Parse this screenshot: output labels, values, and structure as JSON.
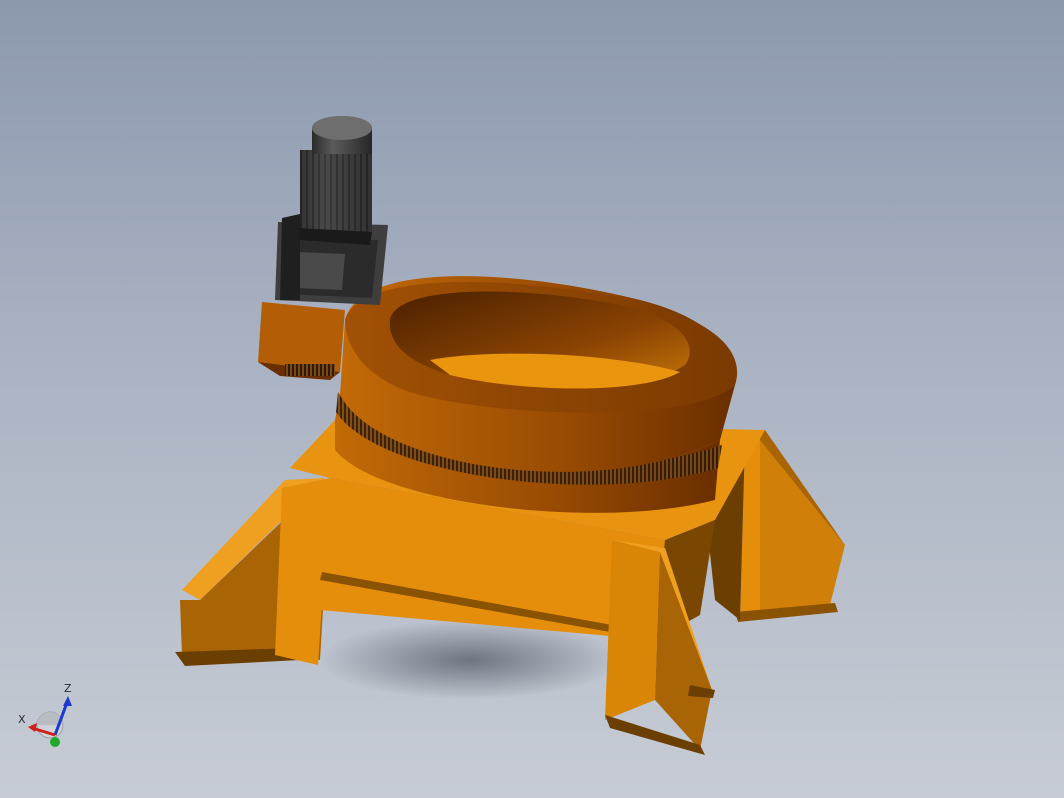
{
  "viewport": {
    "background_top": "#8c98ae",
    "background_bottom": "#c7ccd4"
  },
  "model": {
    "icon": "rotary-positioner-with-gearmotor",
    "colors": {
      "frame": "#e58e0b",
      "frame_shade": "#a86405",
      "frame_dark": "#6b3e02",
      "ring": "#b35e06",
      "ring_dark": "#6a2e00",
      "motor": "#3c3c3c",
      "motor_dark": "#232323"
    }
  },
  "triad": {
    "icon": "view-orientation-triad-icon",
    "x_label": "X",
    "z_label": "Z",
    "colors": {
      "x": "#d0201a",
      "y": "#1fa82a",
      "z": "#1a3ad0"
    }
  }
}
